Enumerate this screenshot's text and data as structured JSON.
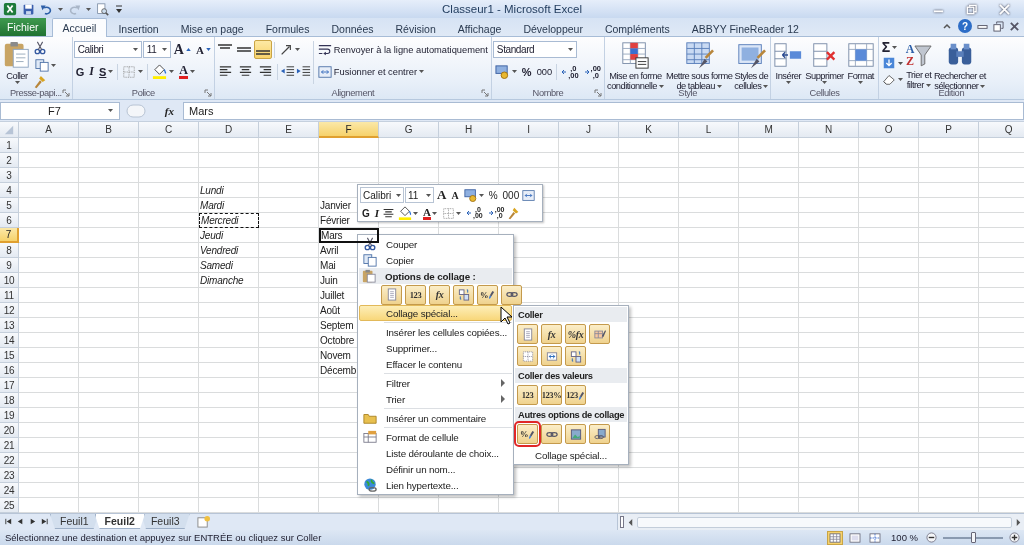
{
  "title_bar": {
    "title": "Classeur1 - Microsoft Excel",
    "help": "?"
  },
  "tabs": [
    {
      "label": "Fichier",
      "kind": "file",
      "selected": false
    },
    {
      "label": "Accueil",
      "kind": "tab",
      "selected": true
    },
    {
      "label": "Insertion",
      "kind": "tab",
      "selected": false
    },
    {
      "label": "Mise en page",
      "kind": "tab",
      "selected": false
    },
    {
      "label": "Formules",
      "kind": "tab",
      "selected": false
    },
    {
      "label": "Données",
      "kind": "tab",
      "selected": false
    },
    {
      "label": "Révision",
      "kind": "tab",
      "selected": false
    },
    {
      "label": "Affichage",
      "kind": "tab",
      "selected": false
    },
    {
      "label": "Développeur",
      "kind": "tab",
      "selected": false
    },
    {
      "label": "Compléments",
      "kind": "tab",
      "selected": false
    },
    {
      "label": "ABBYY FineReader 12",
      "kind": "tab",
      "selected": false
    }
  ],
  "ribbon": {
    "clipboard": {
      "paste_label": "Coller",
      "group_label": "Presse-papi..."
    },
    "font": {
      "font_name": "Calibri",
      "font_size": "11",
      "grow": "A",
      "shrink": "A",
      "bold": "G",
      "italic": "I",
      "underline": "S",
      "font_color": "A",
      "group_label": "Police"
    },
    "alignment": {
      "vertical": [
        {
          "kind": "top",
          "selected": false
        },
        {
          "kind": "middle",
          "selected": false
        },
        {
          "kind": "bottom",
          "selected": true
        }
      ],
      "horizontal": [
        {
          "kind": "left",
          "selected": false
        },
        {
          "kind": "center",
          "selected": false
        },
        {
          "kind": "right",
          "selected": false
        }
      ],
      "wrap_text": "Renvoyer à la ligne automatiquement",
      "merge_center": "Fusionner et centrer",
      "group_label": "Alignement"
    },
    "number": {
      "format": "Standard",
      "percent": "%",
      "thousands": "000",
      "increase_decimal": {
        "top": ",0",
        "bottom": ",00"
      },
      "decrease_decimal": {
        "top": ",00",
        "bottom": ",0"
      },
      "group_label": "Nombre"
    },
    "styles": {
      "buttons": [
        {
          "kind": "conditional",
          "lines": [
            "Mise en forme",
            "conditionnelle"
          ]
        },
        {
          "kind": "table",
          "lines": [
            "Mettre sous forme",
            "de tableau"
          ]
        },
        {
          "kind": "cell-styles",
          "lines": [
            "Styles de",
            "cellules"
          ]
        }
      ],
      "group_label": "Style"
    },
    "cells": {
      "buttons": [
        {
          "kind": "insert",
          "label": "Insérer"
        },
        {
          "kind": "delete",
          "label": "Supprimer"
        },
        {
          "kind": "format",
          "label": "Format"
        }
      ],
      "group_label": "Cellules"
    },
    "editing": {
      "sum": "Σ",
      "buttons": [
        {
          "kind": "sort",
          "lines": [
            "Trier et",
            "filtrer"
          ],
          "glyphs": [
            "A",
            "Z"
          ]
        },
        {
          "kind": "find",
          "lines": [
            "Rechercher et",
            "sélectionner"
          ]
        }
      ],
      "group_label": "Édition"
    }
  },
  "formula_bar": {
    "name_box": "F7",
    "fx": "fx",
    "value": "Mars"
  },
  "sheet": {
    "columns": [
      {
        "label": "A",
        "selected": false
      },
      {
        "label": "B",
        "selected": false
      },
      {
        "label": "C",
        "selected": false
      },
      {
        "label": "D",
        "selected": false
      },
      {
        "label": "E",
        "selected": false
      },
      {
        "label": "F",
        "selected": true
      },
      {
        "label": "G",
        "selected": false
      },
      {
        "label": "H",
        "selected": false
      },
      {
        "label": "I",
        "selected": false
      },
      {
        "label": "J",
        "selected": false
      },
      {
        "label": "K",
        "selected": false
      },
      {
        "label": "L",
        "selected": false
      },
      {
        "label": "M",
        "selected": false
      },
      {
        "label": "N",
        "selected": false
      },
      {
        "label": "O",
        "selected": false
      },
      {
        "label": "P",
        "selected": false
      },
      {
        "label": "Q",
        "selected": false
      }
    ],
    "rows": [
      {
        "number": "1",
        "selected": false
      },
      {
        "number": "2",
        "selected": false
      },
      {
        "number": "3",
        "selected": false
      },
      {
        "number": "4",
        "selected": false,
        "copied": false,
        "column_d": "Lundi"
      },
      {
        "number": "5",
        "selected": false,
        "copied": false,
        "column_d": "Mardi",
        "column_f": "Janvier"
      },
      {
        "number": "6",
        "selected": false,
        "copied": true,
        "column_d": "Mercredi",
        "column_f": "Février"
      },
      {
        "number": "7",
        "selected": true,
        "copied": false,
        "column_d": "Jeudi",
        "column_f": "Mars"
      },
      {
        "number": "8",
        "selected": false,
        "copied": false,
        "column_d": "Vendredi",
        "column_f": "Avril"
      },
      {
        "number": "9",
        "selected": false,
        "copied": false,
        "column_d": "Samedi",
        "column_f": "Mai"
      },
      {
        "number": "10",
        "selected": false,
        "copied": false,
        "column_d": "Dimanche",
        "column_f": "Juin"
      },
      {
        "number": "11",
        "selected": false,
        "column_f": "Juillet"
      },
      {
        "number": "12",
        "selected": false,
        "column_f": "Août"
      },
      {
        "number": "13",
        "selected": false,
        "column_f": "Septem"
      },
      {
        "number": "14",
        "selected": false,
        "column_f": "Octobre"
      },
      {
        "number": "15",
        "selected": false,
        "column_f": "Novem"
      },
      {
        "number": "16",
        "selected": false,
        "column_f": "Décemb"
      },
      {
        "number": "17",
        "selected": false
      },
      {
        "number": "18",
        "selected": false
      },
      {
        "number": "19",
        "selected": false
      },
      {
        "number": "20",
        "selected": false
      },
      {
        "number": "21",
        "selected": false
      },
      {
        "number": "22",
        "selected": false
      },
      {
        "number": "23",
        "selected": false
      },
      {
        "number": "24",
        "selected": false
      },
      {
        "number": "25",
        "selected": false
      }
    ]
  },
  "mini_toolbar": {
    "font_name": "Calibri",
    "font_size": "11",
    "grow": "A",
    "shrink": "A",
    "percent": "%",
    "thousands": "000",
    "bold": "G",
    "italic": "I",
    "font_color": "A",
    "increase_decimal": {
      "top": ",0",
      "bottom": ",00"
    },
    "decrease_decimal": {
      "top": ",00",
      "bottom": ",0"
    }
  },
  "context_menu": {
    "sections": [
      [
        {
          "kind": "cut",
          "label": "Couper",
          "selected": false
        },
        {
          "kind": "copy",
          "label": "Copier",
          "selected": false
        },
        {
          "kind": "header",
          "label": "Options de collage :"
        },
        {
          "kind": "paste-options",
          "tiles": [
            {
              "kind": "paste",
              "selected": false
            },
            {
              "kind": "values",
              "glyph": "123",
              "selected": false
            },
            {
              "kind": "formulas",
              "glyph": "fx",
              "selected": false
            },
            {
              "kind": "transpose",
              "selected": false
            },
            {
              "kind": "formatting",
              "glyph": "%",
              "selected": false
            },
            {
              "kind": "link",
              "selected": false
            }
          ]
        },
        {
          "kind": "command",
          "label": "Collage spécial...",
          "selected": true
        }
      ],
      [
        {
          "kind": "command",
          "label": "Insérer les cellules copiées...",
          "selected": false
        },
        {
          "kind": "command",
          "label": "Supprimer...",
          "selected": false
        },
        {
          "kind": "command",
          "label": "Effacer le contenu",
          "selected": false
        }
      ],
      [
        {
          "kind": "submenu",
          "label": "Filtrer",
          "selected": false
        },
        {
          "kind": "submenu",
          "label": "Trier",
          "selected": false
        }
      ],
      [
        {
          "kind": "comment",
          "label": "Insérer un commentaire",
          "selected": false
        }
      ],
      [
        {
          "kind": "format",
          "label": "Format de cellule",
          "selected": false
        },
        {
          "kind": "command",
          "label": "Liste déroulante de choix...",
          "selected": false
        },
        {
          "kind": "command",
          "label": "Définir un nom...",
          "selected": false
        },
        {
          "kind": "hyperlink",
          "label": "Lien hypertexte...",
          "selected": false
        }
      ]
    ]
  },
  "paste_submenu": {
    "sections": [
      {
        "header": "Coller",
        "tiles": [
          {
            "kind": "paste",
            "selected": false
          },
          {
            "kind": "formulas",
            "glyph": "fx",
            "selected": false
          },
          {
            "kind": "formulas-number",
            "glyph": "%fx",
            "selected": false
          },
          {
            "kind": "keep-source",
            "selected": false
          },
          {
            "kind": "no-borders",
            "selected": false
          },
          {
            "kind": "keep-width",
            "selected": false
          },
          {
            "kind": "transpose",
            "selected": false
          }
        ]
      },
      {
        "header": "Coller des valeurs",
        "tiles": [
          {
            "kind": "values",
            "glyph": "123",
            "selected": false
          },
          {
            "kind": "values-number",
            "glyph": "123%",
            "selected": false
          },
          {
            "kind": "values-source",
            "glyph": "123",
            "selected": false
          }
        ]
      },
      {
        "header": "Autres options de collage",
        "tiles": [
          {
            "kind": "formatting",
            "glyph": "%",
            "selected": true
          },
          {
            "kind": "link",
            "selected": false
          },
          {
            "kind": "picture",
            "selected": false
          },
          {
            "kind": "linked-picture",
            "selected": false
          }
        ]
      }
    ],
    "footer": "Collage spécial..."
  },
  "sheet_tabs": [
    {
      "label": "Feuil1",
      "selected": false
    },
    {
      "label": "Feuil2",
      "selected": true
    },
    {
      "label": "Feuil3",
      "selected": false
    }
  ],
  "status_bar": {
    "message": "Sélectionnez une destination et appuyez sur ENTRÉE ou cliquez sur Coller",
    "views": [
      {
        "kind": "normal",
        "selected": true
      },
      {
        "kind": "page-layout",
        "selected": false
      },
      {
        "kind": "page-break",
        "selected": false
      }
    ],
    "zoom": "100 %",
    "zoom_slider": {
      "level": 0.5
    }
  }
}
